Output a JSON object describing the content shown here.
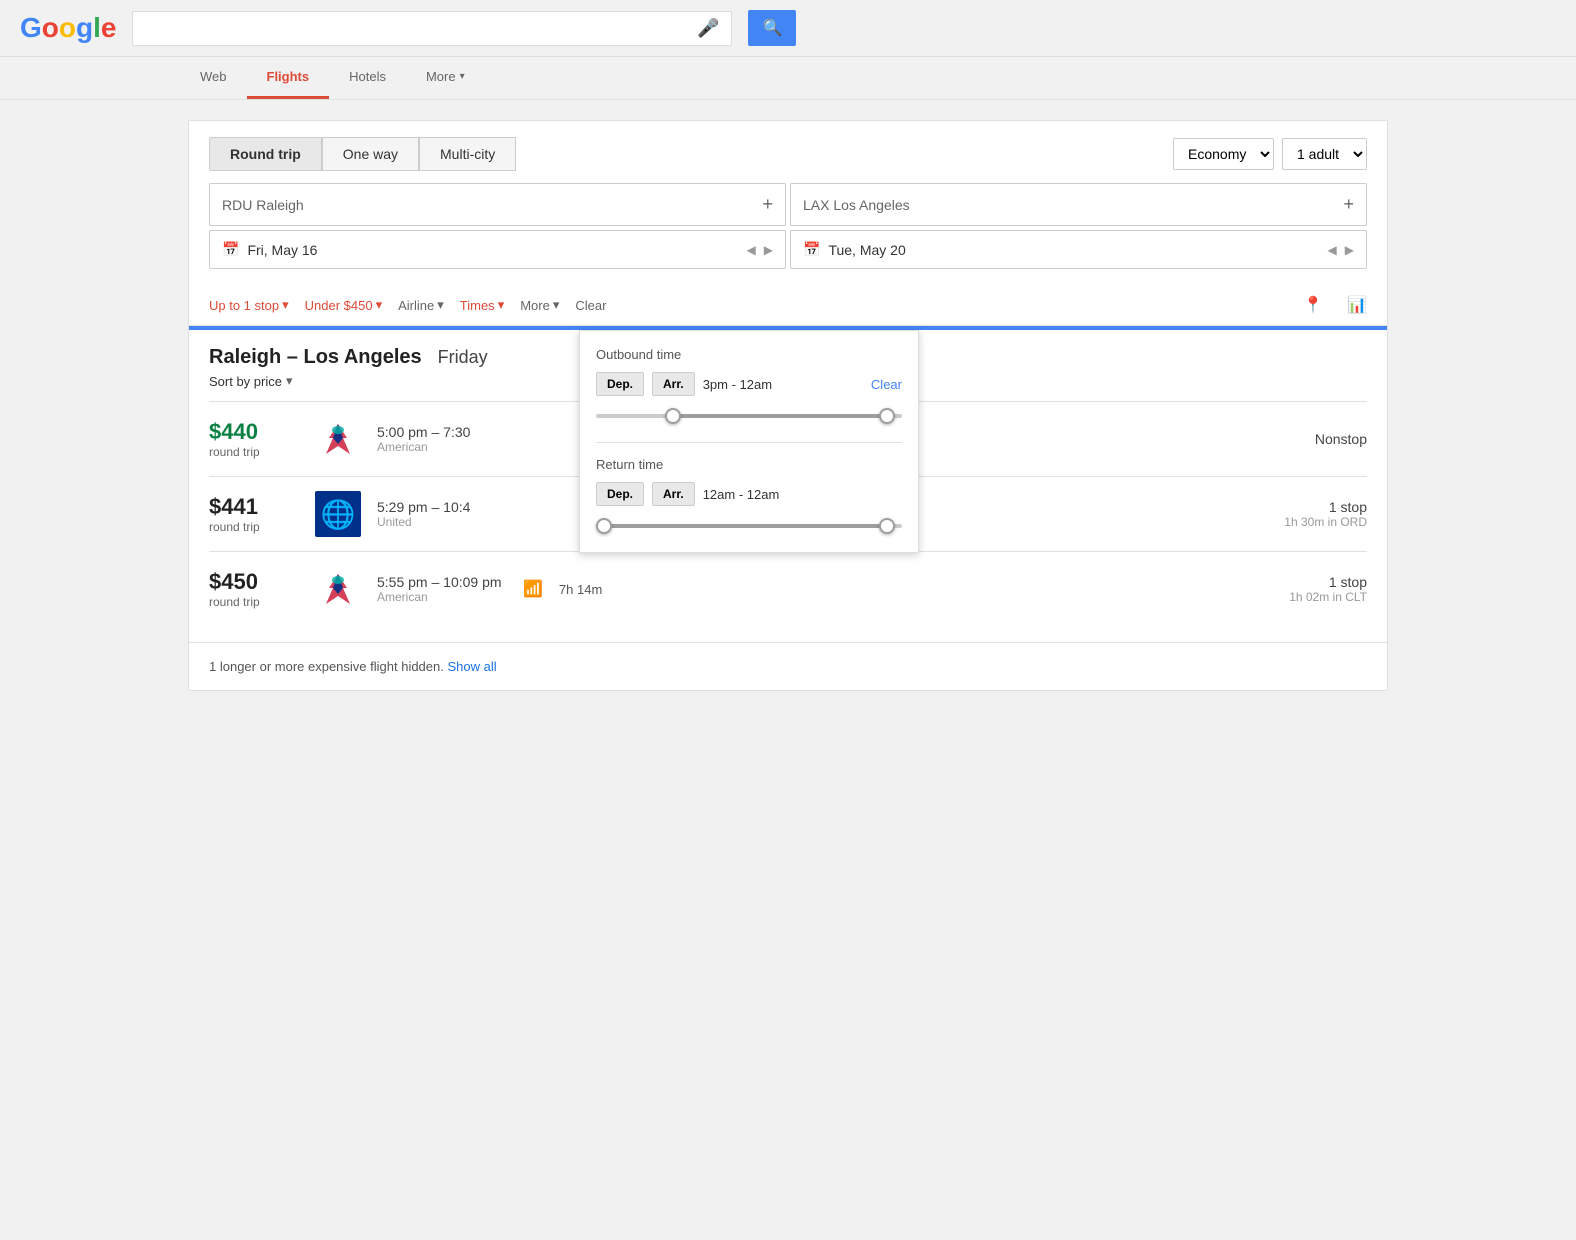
{
  "header": {
    "logo": "Google",
    "logo_letters": [
      "G",
      "o",
      "o",
      "g",
      "l",
      "e"
    ],
    "logo_colors": [
      "#4285F4",
      "#EA4335",
      "#FBBC05",
      "#4285F4",
      "#34A853",
      "#EA4335"
    ],
    "search_placeholder": "",
    "search_value": ""
  },
  "nav": {
    "tabs": [
      {
        "id": "web",
        "label": "Web",
        "active": false
      },
      {
        "id": "flights",
        "label": "Flights",
        "active": true
      },
      {
        "id": "hotels",
        "label": "Hotels",
        "active": false
      },
      {
        "id": "more",
        "label": "More",
        "active": false,
        "has_dropdown": true
      }
    ]
  },
  "flight_form": {
    "trip_types": [
      {
        "id": "round-trip",
        "label": "Round trip",
        "active": true
      },
      {
        "id": "one-way",
        "label": "One way",
        "active": false
      },
      {
        "id": "multi-city",
        "label": "Multi-city",
        "active": false
      }
    ],
    "cabin": "Economy",
    "adults": "1 adult",
    "origin": "RDU Raleigh",
    "destination": "LAX Los Angeles",
    "depart_date": "Fri, May 16",
    "return_date": "Tue, May 20"
  },
  "filters": {
    "stops": "Up to 1 stop",
    "price": "Under $450",
    "airline": "Airline",
    "times": "Times",
    "more": "More",
    "clear": "Clear"
  },
  "results": {
    "title": "Raleigh – Los Angeles",
    "date": "Friday",
    "sort_label": "Sort by price",
    "flights": [
      {
        "price": "$440",
        "price_color": "green",
        "trip_label": "round trip",
        "airline": "American",
        "airline_logo": "american",
        "depart": "5:00 pm",
        "arrive": "7:30",
        "has_wifi": false,
        "duration": "",
        "stops": "Nonstop",
        "stop_detail": ""
      },
      {
        "price": "$441",
        "price_color": "normal",
        "trip_label": "round trip",
        "airline": "United",
        "airline_logo": "united",
        "depart": "5:29 pm",
        "arrive": "10:4",
        "has_wifi": false,
        "duration": "",
        "stops": "1 stop",
        "stop_detail": "1h 30m in ORD"
      },
      {
        "price": "$450",
        "price_color": "normal",
        "trip_label": "round trip",
        "airline": "American",
        "airline_logo": "american",
        "depart": "5:55 pm",
        "arrive": "10:09 pm",
        "has_wifi": true,
        "duration": "7h 14m",
        "stops": "1 stop",
        "stop_detail": "1h 02m in CLT"
      }
    ],
    "footer_text": "1 longer or more expensive flight hidden.",
    "show_all": "Show all"
  },
  "times_dropdown": {
    "outbound_title": "Outbound time",
    "outbound_dep_label": "Dep.",
    "outbound_arr_label": "Arr.",
    "outbound_range": "3pm - 12am",
    "outbound_clear": "Clear",
    "outbound_slider_left": "25%",
    "outbound_slider_right": "5%",
    "return_title": "Return time",
    "return_dep_label": "Dep.",
    "return_arr_label": "Arr.",
    "return_range": "12am - 12am",
    "return_slider_left": "0%",
    "return_slider_right": "5%"
  }
}
